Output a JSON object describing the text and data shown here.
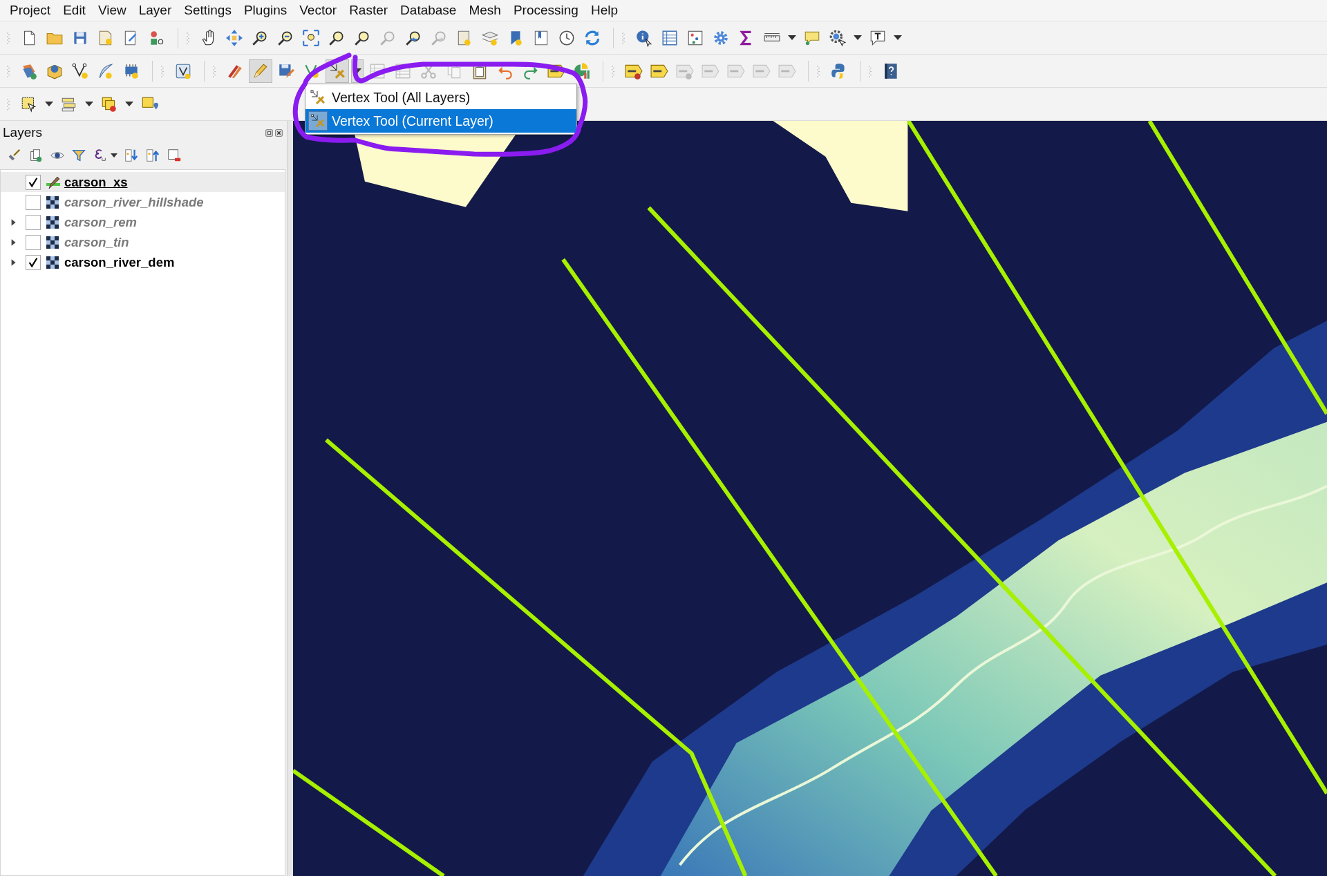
{
  "menu": [
    "Project",
    "Edit",
    "View",
    "Layer",
    "Settings",
    "Plugins",
    "Vector",
    "Raster",
    "Database",
    "Mesh",
    "Processing",
    "Help"
  ],
  "toolbars": [
    {
      "groups": [
        {
          "items": [
            {
              "kind": "file",
              "disabled": false,
              "pressed": false
            },
            {
              "kind": "folder",
              "disabled": false,
              "pressed": false
            },
            {
              "kind": "floppy-disk",
              "disabled": false,
              "pressed": false
            },
            {
              "kind": "page-star",
              "disabled": false,
              "pressed": false
            },
            {
              "kind": "page-wrench",
              "disabled": false,
              "pressed": false
            },
            {
              "kind": "shapes",
              "disabled": false,
              "pressed": false
            }
          ]
        },
        {
          "items": [
            {
              "kind": "hand",
              "disabled": false,
              "pressed": false
            },
            {
              "kind": "pan-arrows",
              "disabled": false,
              "pressed": false
            },
            {
              "kind": "zoom-in",
              "disabled": false,
              "pressed": false
            },
            {
              "kind": "zoom-out",
              "disabled": false,
              "pressed": false
            },
            {
              "kind": "zoom-full",
              "disabled": false,
              "pressed": false
            },
            {
              "kind": "magnifier",
              "disabled": false,
              "pressed": false
            },
            {
              "kind": "magnifier",
              "disabled": false,
              "pressed": false
            },
            {
              "kind": "magnifier",
              "disabled": true,
              "pressed": false
            },
            {
              "kind": "zoom-back",
              "disabled": false,
              "pressed": false
            },
            {
              "kind": "zoom-forward",
              "disabled": true,
              "pressed": false
            },
            {
              "kind": "map-sheet",
              "disabled": false,
              "pressed": false
            },
            {
              "kind": "map-sheets",
              "disabled": false,
              "pressed": false
            },
            {
              "kind": "bookmark",
              "disabled": false,
              "pressed": false
            },
            {
              "kind": "book",
              "disabled": false,
              "pressed": false
            },
            {
              "kind": "clock",
              "disabled": false,
              "pressed": false
            },
            {
              "kind": "refresh",
              "disabled": false,
              "pressed": false
            }
          ]
        },
        {
          "items": [
            {
              "kind": "identify",
              "disabled": false,
              "pressed": false
            },
            {
              "kind": "table",
              "disabled": false,
              "pressed": false
            },
            {
              "kind": "abacus",
              "disabled": false,
              "pressed": false
            },
            {
              "kind": "gear",
              "disabled": false,
              "pressed": false
            },
            {
              "kind": "sigma",
              "disabled": false,
              "pressed": false
            },
            {
              "kind": "ruler",
              "disabled": false,
              "pressed": false
            },
            {
              "kind": "caret",
              "disabled": false,
              "pressed": false
            },
            {
              "kind": "speech-bubble",
              "disabled": false,
              "pressed": false
            },
            {
              "kind": "gear-cursor",
              "disabled": false,
              "pressed": false
            },
            {
              "kind": "caret",
              "disabled": false,
              "pressed": false
            },
            {
              "kind": "text-bubble",
              "disabled": false,
              "pressed": false
            },
            {
              "kind": "caret",
              "disabled": false,
              "pressed": false
            }
          ]
        }
      ]
    },
    {
      "groups": [
        {
          "items": [
            {
              "kind": "layer-add",
              "disabled": false,
              "pressed": false
            },
            {
              "kind": "globe-box",
              "disabled": false,
              "pressed": false
            },
            {
              "kind": "vertex-v",
              "disabled": false,
              "pressed": false
            },
            {
              "kind": "feather",
              "disabled": false,
              "pressed": false
            },
            {
              "kind": "chip",
              "disabled": false,
              "pressed": false
            }
          ]
        },
        {
          "items": [
            {
              "kind": "v-box",
              "disabled": false,
              "pressed": false
            }
          ]
        },
        {
          "items": [
            {
              "kind": "pencils",
              "disabled": false,
              "pressed": false
            },
            {
              "kind": "pencil",
              "disabled": false,
              "pressed": true
            },
            {
              "kind": "save-edits",
              "disabled": false,
              "pressed": false
            },
            {
              "kind": "node-add",
              "disabled": false,
              "pressed": false
            },
            {
              "kind": "vertex-tool",
              "disabled": false,
              "pressed": true
            },
            {
              "kind": "caret",
              "disabled": false,
              "pressed": true
            },
            {
              "kind": "table",
              "disabled": true,
              "pressed": false
            },
            {
              "kind": "table",
              "disabled": true,
              "pressed": false
            },
            {
              "kind": "scissors",
              "disabled": true,
              "pressed": false
            },
            {
              "kind": "copy",
              "disabled": true,
              "pressed": false
            },
            {
              "kind": "clipboard",
              "disabled": false,
              "pressed": false
            },
            {
              "kind": "undo",
              "disabled": false,
              "pressed": false
            },
            {
              "kind": "redo",
              "disabled": false,
              "pressed": false
            },
            {
              "kind": "label-tag",
              "disabled": false,
              "pressed": false
            },
            {
              "kind": "pie-chart",
              "disabled": false,
              "pressed": false
            }
          ]
        },
        {
          "items": [
            {
              "kind": "label-pin",
              "disabled": false,
              "pressed": false
            },
            {
              "kind": "label-tag",
              "disabled": false,
              "pressed": false
            },
            {
              "kind": "label-pin",
              "disabled": true,
              "pressed": false
            },
            {
              "kind": "label-tag",
              "disabled": true,
              "pressed": false
            },
            {
              "kind": "label-tag",
              "disabled": true,
              "pressed": false
            },
            {
              "kind": "label-tag",
              "disabled": true,
              "pressed": false
            },
            {
              "kind": "label-tag",
              "disabled": true,
              "pressed": false
            }
          ]
        },
        {
          "items": [
            {
              "kind": "python",
              "disabled": false,
              "pressed": false
            }
          ]
        },
        {
          "items": [
            {
              "kind": "help-book",
              "disabled": false,
              "pressed": false
            }
          ]
        }
      ]
    },
    {
      "groups": [
        {
          "items": [
            {
              "kind": "select-cursor",
              "disabled": false,
              "pressed": false
            },
            {
              "kind": "caret",
              "disabled": false,
              "pressed": false
            },
            {
              "kind": "select-stack",
              "disabled": false,
              "pressed": false
            },
            {
              "kind": "caret",
              "disabled": false,
              "pressed": false
            },
            {
              "kind": "deselect",
              "disabled": false,
              "pressed": false
            },
            {
              "kind": "caret",
              "disabled": false,
              "pressed": false
            },
            {
              "kind": "select-pin",
              "disabled": false,
              "pressed": false
            }
          ]
        }
      ]
    }
  ],
  "dropdown": {
    "items": [
      {
        "label": "Vertex Tool (All Layers)",
        "selected": false
      },
      {
        "label": "Vertex Tool (Current Layer)",
        "selected": true
      }
    ]
  },
  "layers_panel": {
    "title": "Layers",
    "layers": [
      {
        "name": "carson_xs",
        "kind": "vector",
        "checked": true,
        "selected": true,
        "expandable": false
      },
      {
        "name": "carson_river_hillshade",
        "kind": "raster",
        "checked": false,
        "selected": false,
        "expandable": false
      },
      {
        "name": "carson_rem",
        "kind": "raster",
        "checked": false,
        "selected": false,
        "expandable": true
      },
      {
        "name": "carson_tin",
        "kind": "raster",
        "checked": false,
        "selected": false,
        "expandable": true
      },
      {
        "name": "carson_river_dem",
        "kind": "raster",
        "checked": true,
        "selected": false,
        "expandable": true
      }
    ]
  }
}
